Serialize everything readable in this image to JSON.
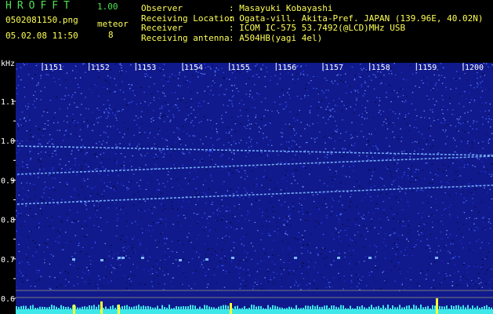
{
  "header": {
    "app_title": "HROFFT",
    "version": "1.00",
    "filename": "0502081150.png",
    "meteor_label": "meteor",
    "meteor_count": "8",
    "datetime": "05.02.08 11:50"
  },
  "station_info": [
    {
      "label": "Observer",
      "value": ": Masayuki Kobayashi"
    },
    {
      "label": "Receiving Location",
      "value": ": Ogata-vill. Akita-Pref. JAPAN (139.96E, 40.02N)"
    },
    {
      "label": "Receiver",
      "value": ": ICOM IC-575 53.7492(@LCD)MHz USB"
    },
    {
      "label": "Receiving antenna",
      "value": ": A504HB(yagi 4el)"
    }
  ],
  "spectrogram": {
    "freq_unit": "kHz",
    "freq_ticks": [
      "1.1",
      "1.0",
      "0.9",
      "0.8",
      "0.7",
      "0.6"
    ],
    "time_ticks": [
      "1151",
      "1152",
      "1153",
      "1154",
      "1155",
      "1156",
      "1157",
      "1158",
      "1159",
      "1200"
    ]
  },
  "colors": {
    "header_green": "#4de34d",
    "header_yellow": "#ffff55",
    "background_noise": "#101a8c",
    "trace": "#7fb8ff",
    "level_bar": "#3fe8e8",
    "level_spike": "#ffff33"
  }
}
